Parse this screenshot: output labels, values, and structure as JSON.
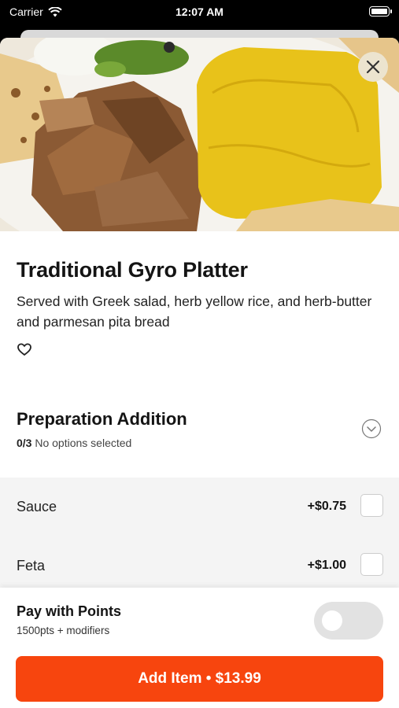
{
  "status_bar": {
    "carrier": "Carrier",
    "time": "12:07 AM"
  },
  "item": {
    "name": "Traditional Gyro Platter",
    "description": "Served with Greek salad, herb yellow rice, and herb-butter and parmesan pita bread"
  },
  "preparation": {
    "title": "Preparation Addition",
    "count": "0/3",
    "status": "No options selected",
    "options": [
      {
        "name": "Sauce",
        "price": "+$0.75",
        "checked": false
      },
      {
        "name": "Feta",
        "price": "+$1.00",
        "checked": false
      }
    ]
  },
  "points": {
    "title": "Pay with Points",
    "subtitle": "1500pts + modifiers",
    "enabled": false
  },
  "add_button": {
    "label": "Add Item • $13.99"
  },
  "colors": {
    "accent": "#f7450e",
    "rice": "#e8c21a",
    "close_bg": "#ece4cf"
  },
  "icons": {
    "close": "close-icon",
    "favorite": "heart-outline-icon",
    "expand": "chevron-down-circle-icon",
    "wifi": "wifi-icon",
    "battery": "battery-icon"
  }
}
